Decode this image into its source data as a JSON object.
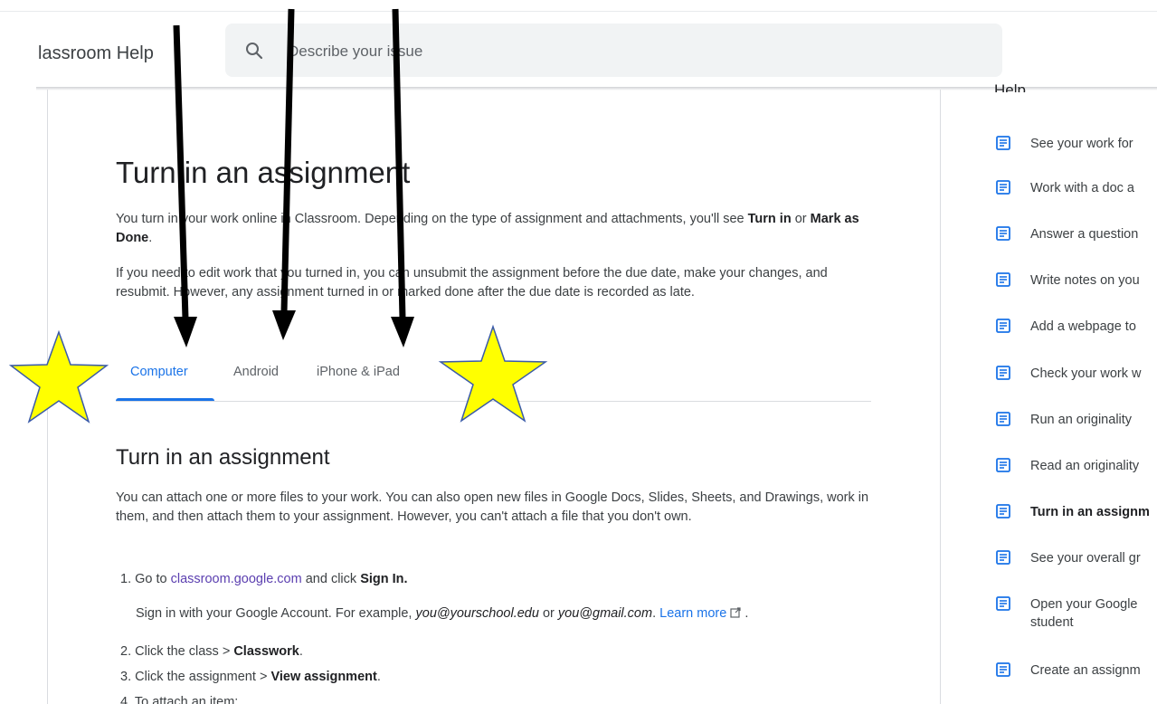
{
  "header": {
    "title": "lassroom Help",
    "search_placeholder": "Describe your issue"
  },
  "article": {
    "title": "Turn in an assignment",
    "intro": {
      "text1": "You turn in your work online in Classroom. Depending on the type of assignment and attachments, you'll see ",
      "bold1": "Turn in",
      "text2": " or ",
      "bold2": "Mark as Done",
      "text3": "."
    },
    "edit_note": "If you need to edit work that you turned in, you can unsubmit the assignment before the due date, make your changes, and resubmit. However, any assignment turned in or marked done after the due date is recorded as late.",
    "tabs": [
      {
        "label": "Computer",
        "active": true
      },
      {
        "label": "Android",
        "active": false
      },
      {
        "label": "iPhone & iPad",
        "active": false
      }
    ],
    "section_title": "Turn in an assignment",
    "section_intro": "You can attach one or more files to your work. You can also open new files in Google Docs, Slides, Sheets, and Drawings, work in them, and then attach them to your assignment. However, you can't attach a file that you don't own.",
    "steps": {
      "s1_num": "1.",
      "s1_text": "Go to ",
      "s1_link": "classroom.google.com",
      "s1_text2": " and click ",
      "s1_bold": "Sign In.",
      "note_text1": "Sign in with your Google Account. For example, ",
      "note_italic1": "you@yourschool.edu",
      "note_text2": " or ",
      "note_italic2": "you@gmail.com",
      "note_text3": ". ",
      "note_link": "Learn more",
      "note_text4": " .",
      "s2_num": "2.",
      "s2_text": "Click the class ",
      "s2_sep": ">",
      "s2_bold": "Classwork",
      "s2_end": ".",
      "s3_num": "3.",
      "s3_text": "Click the assignment ",
      "s3_sep": ">",
      "s3_bold": "View assignment",
      "s3_end": ".",
      "s4": "4. To attach an item:"
    }
  },
  "sidebar": {
    "heading": "Help",
    "items": [
      {
        "label": "See your work for",
        "bold": false
      },
      {
        "label": "Work with a doc a",
        "bold": false
      },
      {
        "label": "Answer a question",
        "bold": false
      },
      {
        "label": "Write notes on you",
        "bold": false
      },
      {
        "label": "Add a webpage to",
        "bold": false
      },
      {
        "label": "Check your work w",
        "bold": false
      },
      {
        "label": "Run an originality",
        "bold": false
      },
      {
        "label": "Read an originality",
        "bold": false
      },
      {
        "label": "Turn in an assignm",
        "bold": true
      },
      {
        "label": "See your overall gr",
        "bold": false
      },
      {
        "label": "Open your Google student",
        "bold": false
      },
      {
        "label": "Create an assignm",
        "bold": false
      }
    ]
  },
  "colors": {
    "accent_blue": "#1a73e8",
    "link_purple": "#5b3fb0",
    "star_fill": "#ffff00",
    "star_stroke": "#3b5ba9",
    "arrow": "#000000"
  }
}
